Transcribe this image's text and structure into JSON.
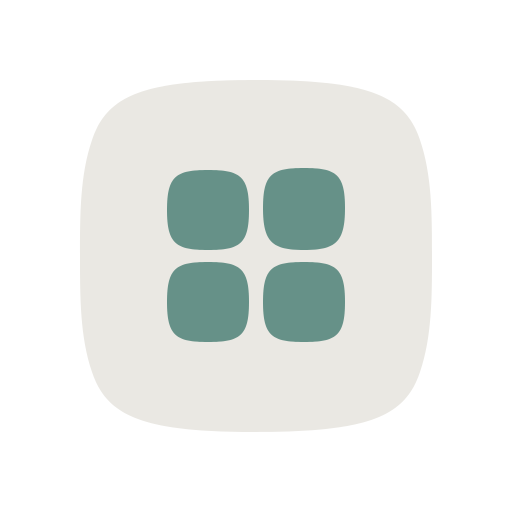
{
  "icon": {
    "name": "app-grid-icon",
    "background_color": "#EAE8E3",
    "tile_color": "#669188",
    "tile_count": 4
  }
}
